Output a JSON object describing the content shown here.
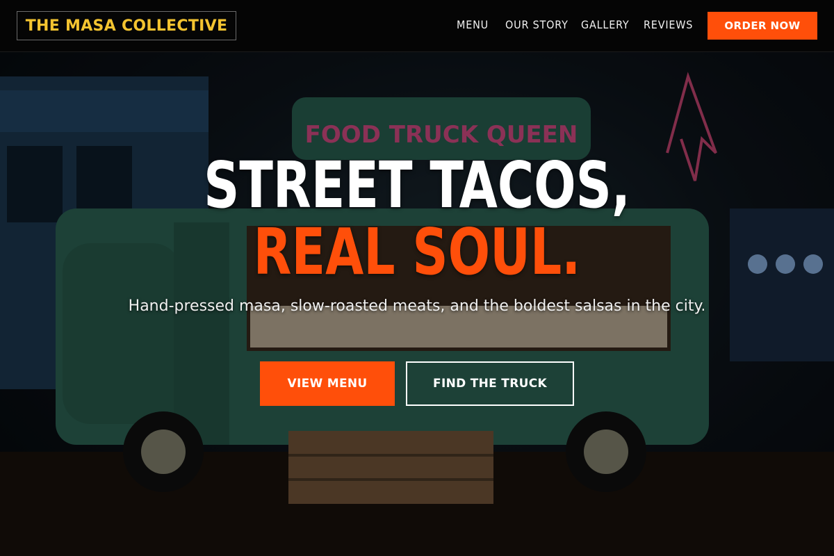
{
  "brand": {
    "name": "THE MASA COLLECTIVE",
    "logo_color": "#f4c430",
    "accent": "#ff4f0a"
  },
  "nav": {
    "items": [
      {
        "label": "MENU"
      },
      {
        "label": "OUR STORY"
      },
      {
        "label": "GALLERY"
      },
      {
        "label": "REVIEWS"
      }
    ],
    "cta_label": "ORDER NOW"
  },
  "hero": {
    "headline_part1": "STREET TACOS,",
    "headline_accent": "REAL SOUL.",
    "subheadline": "Hand-pressed masa, slow-roasted meats, and the boldest salsas in the city.",
    "primary_button": "VIEW MENU",
    "secondary_button": "FIND THE TRUCK",
    "background_sign_text": "FOOD TRUCK QUEEN"
  }
}
